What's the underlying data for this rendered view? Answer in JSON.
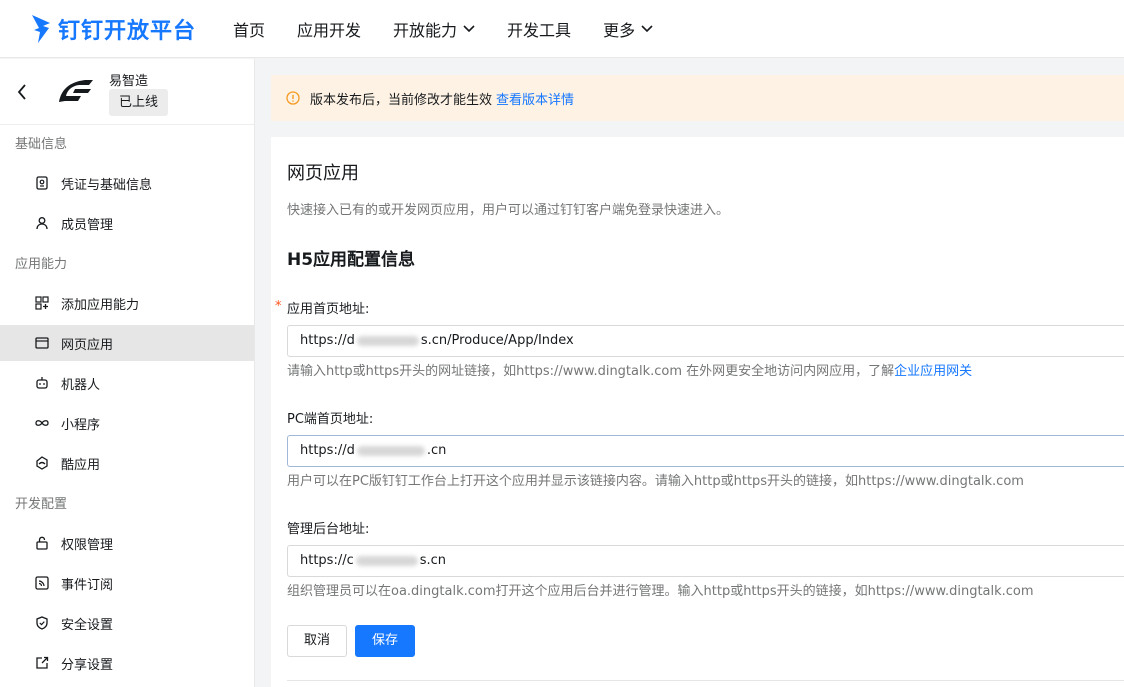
{
  "brand": {
    "name": "钉钉开放平台",
    "color": "#1677ff"
  },
  "nav": {
    "items": [
      {
        "label": "首页",
        "dropdown": false
      },
      {
        "label": "应用开发",
        "dropdown": false
      },
      {
        "label": "开放能力",
        "dropdown": true
      },
      {
        "label": "开发工具",
        "dropdown": false
      },
      {
        "label": "更多",
        "dropdown": true
      }
    ]
  },
  "app": {
    "name": "易智造",
    "status": "已上线"
  },
  "sidebar": {
    "sections": [
      {
        "title": "基础信息",
        "items": [
          {
            "label": "凭证与基础信息",
            "icon": "credential-icon"
          },
          {
            "label": "成员管理",
            "icon": "user-icon"
          }
        ]
      },
      {
        "title": "应用能力",
        "items": [
          {
            "label": "添加应用能力",
            "icon": "add-capability-icon"
          },
          {
            "label": "网页应用",
            "icon": "browser-window-icon",
            "active": true
          },
          {
            "label": "机器人",
            "icon": "robot-icon"
          },
          {
            "label": "小程序",
            "icon": "infinity-icon"
          },
          {
            "label": "酷应用",
            "icon": "cool-app-icon"
          }
        ]
      },
      {
        "title": "开发配置",
        "items": [
          {
            "label": "权限管理",
            "icon": "lock-icon"
          },
          {
            "label": "事件订阅",
            "icon": "rss-icon"
          },
          {
            "label": "安全设置",
            "icon": "shield-icon"
          },
          {
            "label": "分享设置",
            "icon": "share-icon"
          }
        ]
      }
    ]
  },
  "notice": {
    "text": "版本发布后，当前修改才能生效",
    "link": "查看版本详情",
    "color": "#fdf2e3"
  },
  "page": {
    "title": "网页应用",
    "desc": "快速接入已有的或开发网页应用，用户可以通过钉钉客户端免登录快速进入。",
    "section_title": "H5应用配置信息"
  },
  "form": {
    "homepage": {
      "label": "应用首页地址:",
      "required_mark": "*",
      "value_prefix": "https://d",
      "value_suffix": "s.cn/Produce/App/Index",
      "help": "请输入http或https开头的网址链接，如https://www.dingtalk.com 在外网更安全地访问内网应用，了解",
      "help_link": "企业应用网关"
    },
    "pc_homepage": {
      "label": "PC端首页地址:",
      "value_prefix": "https://d",
      "value_suffix": ".cn",
      "help": "用户可以在PC版钉钉工作台上打开这个应用并显示该链接内容。请输入http或https开头的链接，如https://www.dingtalk.com"
    },
    "admin_url": {
      "label": "管理后台地址:",
      "value_prefix": "https://c",
      "value_suffix": "s.cn",
      "help": "组织管理员可以在oa.dingtalk.com打开这个应用后台并进行管理。输入http或https开头的链接，如https://www.dingtalk.com"
    }
  },
  "buttons": {
    "cancel": "取消",
    "save": "保存"
  }
}
